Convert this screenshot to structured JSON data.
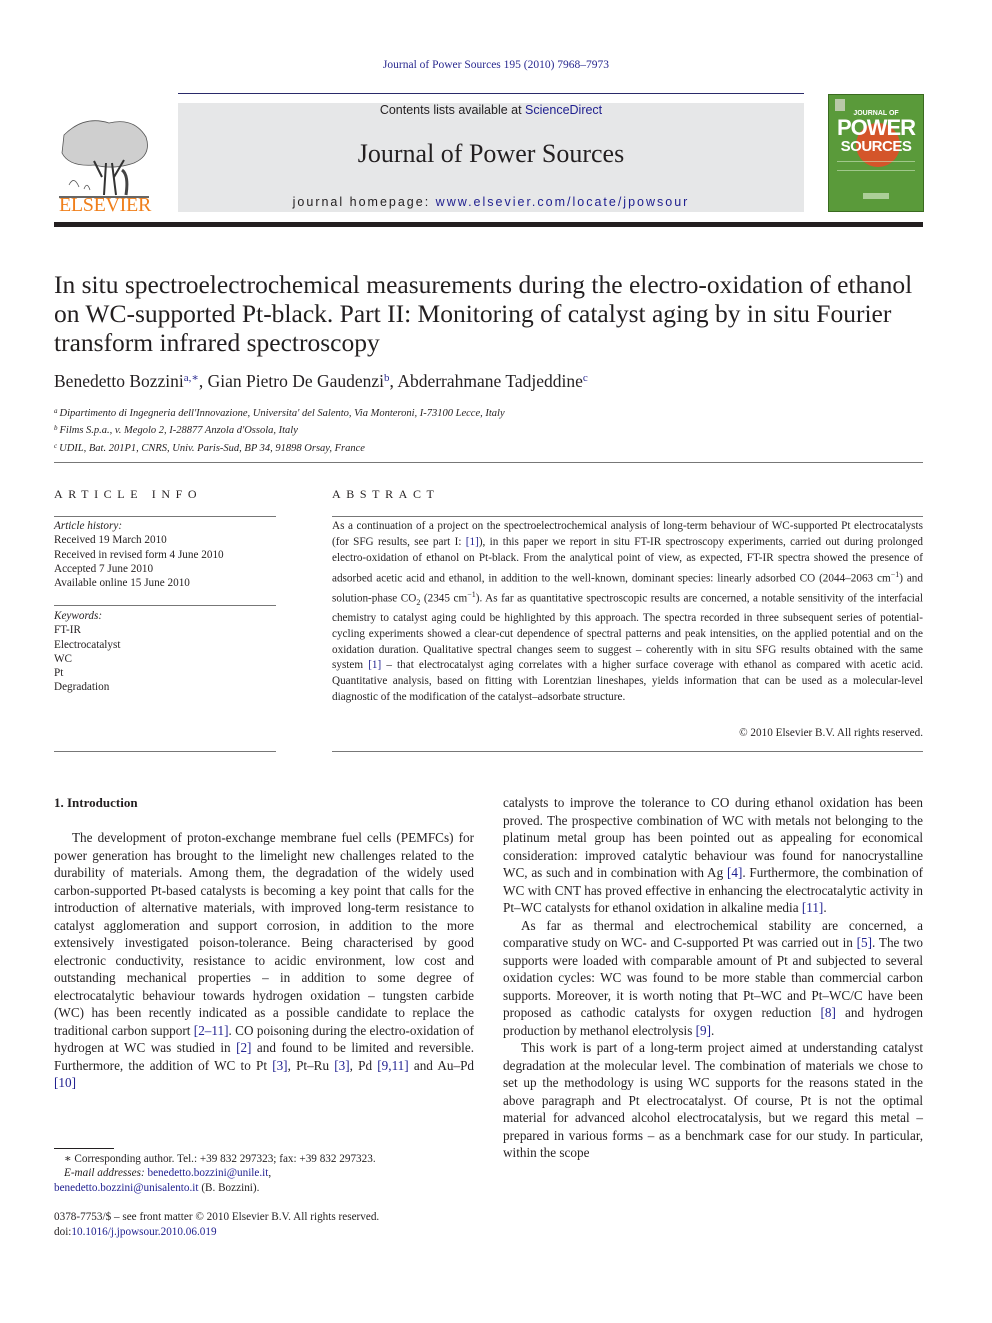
{
  "running_head": "Journal of Power Sources 195 (2010) 7968–7973",
  "masthead": {
    "contents_prefix": "Contents lists available at ",
    "contents_link": "ScienceDirect",
    "journal_name": "Journal of Power Sources",
    "homepage_prefix": "journal homepage: ",
    "homepage_link": "www.elsevier.com/locate/jpowsour",
    "publisher_logo_text": "ELSEVIER",
    "cover": {
      "top_text": "JOURNAL OF",
      "title_line1": "POWER",
      "title_line2": "SOURCES"
    },
    "colors": {
      "elsevier_orange": "#f07f1b",
      "link_blue": "#1f1f8f",
      "masthead_gray": "#e6e7e8",
      "cover_green": "#5a9a3a"
    }
  },
  "article": {
    "title": "In situ spectroelectrochemical measurements during the electro-oxidation of ethanol on WC-supported Pt-black. Part II: Monitoring of catalyst aging by in situ Fourier transform infrared spectroscopy",
    "authors": [
      {
        "name": "Benedetto Bozzini",
        "marks": "a,∗",
        "sep": ", "
      },
      {
        "name": "Gian Pietro De Gaudenzi",
        "marks": "b",
        "sep": ", "
      },
      {
        "name": "Abderrahmane Tadjeddine",
        "marks": "c",
        "sep": ""
      }
    ],
    "affiliations": [
      {
        "mark": "a",
        "text": "Dipartimento di Ingegneria dell'Innovazione, Universita' del Salento, Via Monteroni, I-73100 Lecce, Italy"
      },
      {
        "mark": "b",
        "text": "Films S.p.a., v. Megolo 2, I-28877 Anzola d'Ossola, Italy"
      },
      {
        "mark": "c",
        "text": "UDIL, Bat. 201P1, CNRS, Univ. Paris-Sud, BP 34, 91898 Orsay, France"
      }
    ]
  },
  "article_info": {
    "heading": "ARTICLE INFO",
    "history_label": "Article history:",
    "history": [
      "Received 19 March 2010",
      "Received in revised form 4 June 2010",
      "Accepted 7 June 2010",
      "Available online 15 June 2010"
    ],
    "keywords_label": "Keywords:",
    "keywords": [
      "FT-IR",
      "Electrocatalyst",
      "WC",
      "Pt",
      "Degradation"
    ]
  },
  "abstract": {
    "heading": "ABSTRACT",
    "part1": "As a continuation of a project on the spectroelectrochemical analysis of long-term behaviour of WC-supported Pt electrocatalysts (for SFG results, see part I: ",
    "ref1": "[1]",
    "part2": "), in this paper we report in situ FT-IR spectroscopy experiments, carried out during prolonged electro-oxidation of ethanol on Pt-black. From the analytical point of view, as expected, FT-IR spectra showed the presence of adsorbed acetic acid and ethanol, in addition to the well-known, dominant species: linearly adsorbed CO (2044–2063 cm",
    "sup1": "−1",
    "part3": ") and solution-phase CO",
    "sub1": "2",
    "part4": " (2345 cm",
    "sup2": "−1",
    "part5": "). As far as quantitative spectroscopic results are concerned, a notable sensitivity of the interfacial chemistry to catalyst aging could be highlighted by this approach. The spectra recorded in three subsequent series of potential-cycling experiments showed a clear-cut dependence of spectral patterns and peak intensities, on the applied potential and on the oxidation duration. Qualitative spectral changes seem to suggest – coherently with in situ SFG results obtained with the same system ",
    "ref2": "[1]",
    "part6": " – that electrocatalyst aging correlates with a higher surface coverage with ethanol as compared with acetic acid. Quantitative analysis, based on fitting with Lorentzian lineshapes, yields information that can be used as a molecular-level diagnostic of the modification of the catalyst–adsorbate structure.",
    "copyright": "© 2010 Elsevier B.V. All rights reserved."
  },
  "introduction": {
    "heading": "1.  Introduction",
    "left_p1": [
      {
        "t": "The development of proton-exchange membrane fuel cells (PEMFCs) for power generation has brought to the limelight new challenges related to the durability of materials. Among them, the degradation of the widely used carbon-supported Pt-based catalysts is becoming a key point that calls for the introduction of alternative materials, with improved long-term resistance to catalyst agglomeration and support corrosion, in addition to the more extensively investigated poison-tolerance. Being characterised by good electronic conductivity, resistance to acidic environment, low cost and outstanding mechanical properties – in addition to some degree of electrocatalytic behaviour towards hydrogen oxidation – tungsten carbide (WC) has been recently indicated as a possible candidate to replace the traditional carbon support "
      },
      {
        "ref": "[2–11]"
      },
      {
        "t": ". CO poisoning during the electro-oxidation of hydrogen at WC was studied in "
      },
      {
        "ref": "[2]"
      },
      {
        "t": " and found to be limited and reversible. Furthermore, the addition of WC to Pt "
      },
      {
        "ref": "[3]"
      },
      {
        "t": ", Pt–Ru "
      },
      {
        "ref": "[3]"
      },
      {
        "t": ", Pd "
      },
      {
        "ref": "[9,11]"
      },
      {
        "t": " and Au–Pd "
      },
      {
        "ref": "[10]"
      }
    ],
    "right_p1": [
      {
        "t": "catalysts to improve the tolerance to CO during ethanol oxidation has been proved. The prospective combination of WC with metals not belonging to the platinum metal group has been pointed out as appealing for economical consideration: improved catalytic behaviour was found for nanocrystalline WC, as such and in combination with Ag "
      },
      {
        "ref": "[4]"
      },
      {
        "t": ". Furthermore, the combination of WC with CNT has proved effective in enhancing the electrocatalytic activity in Pt–WC catalysts for ethanol oxidation in alkaline media "
      },
      {
        "ref": "[11]"
      },
      {
        "t": "."
      }
    ],
    "right_p2": [
      {
        "t": "As far as thermal and electrochemical stability are concerned, a comparative study on WC- and C-supported Pt was carried out in "
      },
      {
        "ref": "[5]"
      },
      {
        "t": ". The two supports were loaded with comparable amount of Pt and subjected to several oxidation cycles: WC was found to be more stable than commercial carbon supports. Moreover, it is worth noting that Pt–WC and Pt–WC/C have been proposed as cathodic catalysts for oxygen reduction "
      },
      {
        "ref": "[8]"
      },
      {
        "t": " and hydrogen production by methanol electrolysis "
      },
      {
        "ref": "[9]"
      },
      {
        "t": "."
      }
    ],
    "right_p3": [
      {
        "t": "This work is part of a long-term project aimed at understanding catalyst degradation at the molecular level. The combination of materials we chose to set up the methodology is using WC supports for the reasons stated in the above paragraph and Pt electrocatalyst. Of course, Pt is not the optimal material for advanced alcohol electrocatalysis, but we regard this metal – prepared in various forms – as a benchmark case for our study. In particular, within the scope"
      }
    ]
  },
  "footnote": {
    "star_line": "∗ Corresponding author. Tel.: +39 832 297323; fax: +39 832 297323.",
    "email_label": "E-mail addresses: ",
    "email1": "benedetto.bozzini@unile.it",
    "email2": "benedetto.bozzini@unisalento.it",
    "email_suffix": " (B. Bozzini)."
  },
  "front_matter": {
    "issn_line": "0378-7753/$ – see front matter © 2010 Elsevier B.V. All rights reserved.",
    "doi_prefix": "doi:",
    "doi": "10.1016/j.jpowsour.2010.06.019"
  }
}
